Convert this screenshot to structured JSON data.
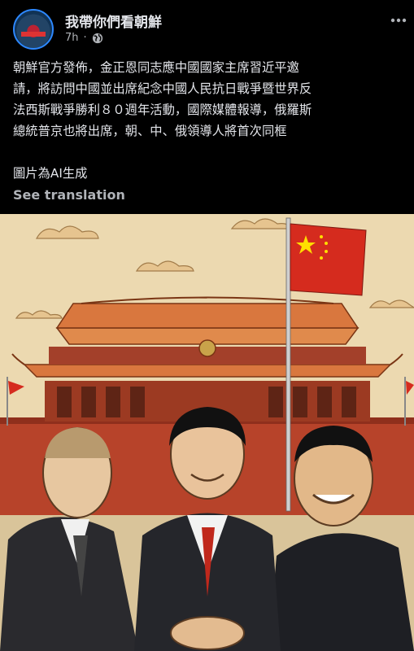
{
  "post": {
    "page_name": "我帶你們看朝鮮",
    "time": "7h",
    "privacy_icon": "globe-icon",
    "text_lines": [
      "朝鮮官方發佈，金正恩同志應中國國家主席習近平邀",
      "請，將訪問中國並出席紀念中國人民抗日戰爭暨世界反",
      "法西斯戰爭勝利８０週年活動，國際媒體報導，俄羅斯",
      "總統普京也將出席，朝、中、俄領導人將首次同框"
    ],
    "ai_note": "圖片為AI生成",
    "see_translation": "See translation"
  },
  "colors": {
    "background": "#000000",
    "text": "#e4e6eb",
    "muted": "#b0b3b8",
    "flag_red": "#d52b1e",
    "flag_star": "#ffde00"
  }
}
